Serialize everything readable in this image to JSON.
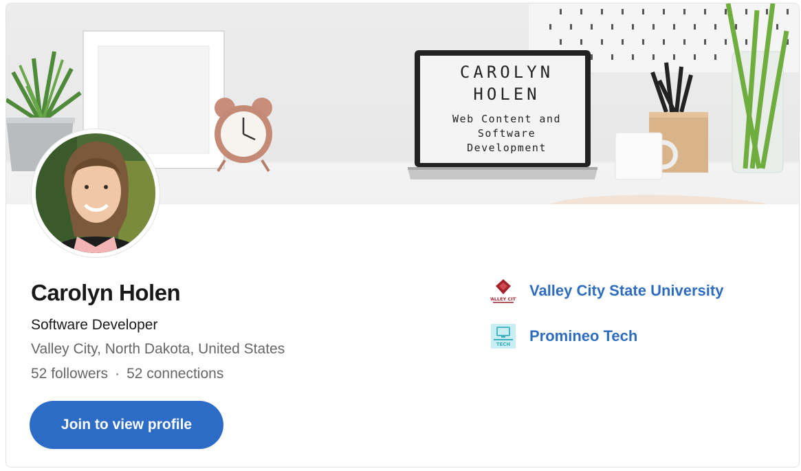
{
  "banner": {
    "laptop_name_line1": "CAROLYN",
    "laptop_name_line2": "HOLEN",
    "laptop_sub_line1": "Web Content and",
    "laptop_sub_line2": "Software",
    "laptop_sub_line3": "Development"
  },
  "profile": {
    "name": "Carolyn Holen",
    "headline": "Software Developer",
    "location": "Valley City, North Dakota, United States",
    "followers": "52 followers",
    "separator": "·",
    "connections": "52 connections",
    "join_button": "Join to view profile"
  },
  "organizations": [
    {
      "name": "Valley City State University",
      "logo_text": "VALLEY CITY",
      "icon": "university-logo"
    },
    {
      "name": "Promineo Tech",
      "logo_text": "TECH",
      "icon": "promineo-logo"
    }
  ],
  "colors": {
    "accent": "#2d6cc6",
    "link": "#2e6cc0",
    "text": "#191919",
    "muted": "#666666"
  }
}
